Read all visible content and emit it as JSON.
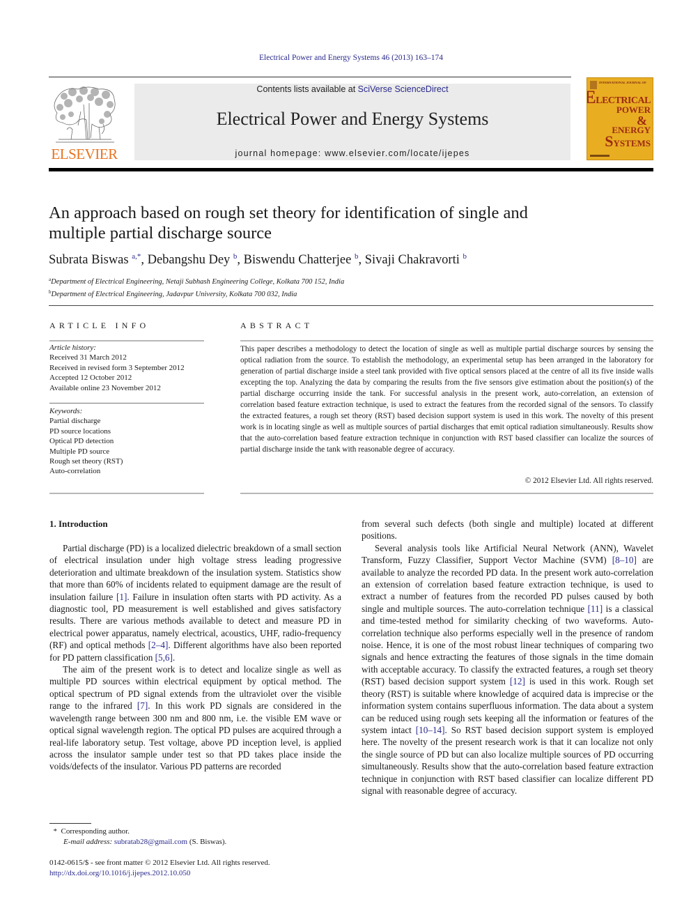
{
  "header": {
    "citation": "Electrical Power and Energy Systems 46 (2013) 163–174",
    "contents_prefix": "Contents lists available at ",
    "contents_link": "SciVerse ScienceDirect",
    "journal_name": "Electrical Power and Energy Systems",
    "homepage": "journal homepage: www.elsevier.com/locate/ijepes",
    "publisher_logo": "ELSEVIER",
    "cover": {
      "intl": "INTERNATIONAL JOURNAL OF",
      "line1_big": "E",
      "line1": "LECTRICAL",
      "line2": "POWER",
      "line3": "&",
      "line4": "ENERGY",
      "line5_big": "S",
      "line5": "YSTEMS"
    }
  },
  "article": {
    "title": "An approach based on rough set theory for identification of single and multiple partial discharge source",
    "authors": [
      {
        "name": "Subrata Biswas",
        "sup": "a,*"
      },
      {
        "name": "Debangshu Dey",
        "sup": "b"
      },
      {
        "name": "Biswendu Chatterjee",
        "sup": "b"
      },
      {
        "name": "Sivaji Chakravorti",
        "sup": "b"
      }
    ],
    "affiliations": [
      {
        "mark": "a",
        "text": "Department of Electrical Engineering, Netaji Subhash Engineering College, Kolkata 700 152, India"
      },
      {
        "mark": "b",
        "text": "Department of Electrical Engineering, Jadavpur University, Kolkata 700 032, India"
      }
    ]
  },
  "article_info": {
    "heading": "ARTICLE INFO",
    "history_label": "Article history:",
    "history": [
      "Received 31 March 2012",
      "Received in revised form 3 September 2012",
      "Accepted 12 October 2012",
      "Available online 23 November 2012"
    ],
    "keywords_label": "Keywords:",
    "keywords": [
      "Partial discharge",
      "PD source locations",
      "Optical PD detection",
      "Multiple PD source",
      "Rough set theory (RST)",
      "Auto-correlation"
    ]
  },
  "abstract": {
    "heading": "ABSTRACT",
    "text": "This paper describes a methodology to detect the location of single as well as multiple partial discharge sources by sensing the optical radiation from the source. To establish the methodology, an experimental setup has been arranged in the laboratory for generation of partial discharge inside a steel tank provided with five optical sensors placed at the centre of all its five inside walls excepting the top. Analyzing the data by comparing the results from the five sensors give estimation about the position(s) of the partial discharge occurring inside the tank. For successful analysis in the present work, auto-correlation, an extension of correlation based feature extraction technique, is used to extract the features from the recorded signal of the sensors. To classify the extracted features, a rough set theory (RST) based decision support system is used in this work. The novelty of this present work is in locating single as well as multiple sources of partial discharges that emit optical radiation simultaneously. Results show that the auto-correlation based feature extraction technique in conjunction with RST based classifier can localize the sources of partial discharge inside the tank with reasonable degree of accuracy.",
    "copyright": "© 2012 Elsevier Ltd. All rights reserved."
  },
  "introduction": {
    "heading": "1. Introduction",
    "p1": {
      "a": "Partial discharge (PD) is a localized dielectric breakdown of a small section of electrical insulation under high voltage stress leading progressive deterioration and ultimate breakdown of the insulation system. Statistics show that more than 60% of incidents related to equipment damage are the result of insulation failure ",
      "ref1": "[1]",
      "b": ". Failure in insulation often starts with PD activity. As a diagnostic tool, PD measurement is well established and gives satisfactory results. There are various methods available to detect and measure PD in electrical power apparatus, namely electrical, acoustics, UHF, radio-frequency (RF) and optical methods ",
      "ref2": "[2–4]",
      "c": ". Different algorithms have also been reported for PD pattern classification ",
      "ref3": "[5,6]",
      "d": "."
    },
    "p2": {
      "a": "The aim of the present work is to detect and localize single as well as multiple PD sources within electrical equipment by optical method. The optical spectrum of PD signal extends from the ultraviolet over the visible range to the infrared ",
      "ref1": "[7]",
      "b": ". In this work PD signals are considered in the wavelength range between 300 nm and 800 nm, i.e. the visible EM wave or optical signal wavelength region. The optical PD pulses are acquired through a real-life laboratory setup. Test voltage, above PD inception level, is applied across the insulator sample under test so that PD takes place inside the voids/defects of the insulator. Various PD patterns are recorded from several such defects (both single and multiple) located at different positions."
    },
    "p2_split": {
      "left": "The aim of the present work is to detect and localize single as well as multiple PD sources within electrical equipment by optical method. The optical spectrum of PD signal extends from the ultraviolet over the visible range to the infrared ",
      "ref1": "[7]",
      "left_b": ". In this work PD signals are considered in the wavelength range between 300 nm and 800 nm, i.e. the visible EM wave or optical signal wavelength region. The optical PD pulses are acquired through a real-life laboratory setup. Test voltage, above PD inception level, is applied across the insulator sample under test so that PD takes place inside the voids/defects of the insulator. Various PD patterns are recorded",
      "right": "from several such defects (both single and multiple) located at different positions."
    },
    "p3": {
      "a": "Several analysis tools like Artificial Neural Network (ANN), Wavelet Transform, Fuzzy Classifier, Support Vector Machine (SVM) ",
      "ref1": "[8–10]",
      "b": " are available to analyze the recorded PD data. In the present work auto-correlation an extension of correlation based feature extraction technique, is used to extract a number of features from the recorded PD pulses caused by both single and multiple sources. The auto-correlation technique ",
      "ref2": "[11]",
      "c": " is a classical and time-tested method for similarity checking of two waveforms. Auto-correlation technique also performs especially well in the presence of random noise. Hence, it is one of the most robust linear techniques of comparing two signals and hence extracting the features of those signals in the time domain with acceptable accuracy. To classify the extracted features, a rough set theory (RST) based decision support system ",
      "ref3": "[12]",
      "d": " is used in this work. Rough set theory (RST) is suitable where knowledge of acquired data is imprecise or the information system contains superfluous information. The data about a system can be reduced using rough sets keeping all the information or features of the system intact ",
      "ref4": "[10–14]",
      "e": ". So RST based decision support system is employed here. The novelty of the present research work is that it can localize not only the single source of PD but can also localize multiple sources of PD occurring simultaneously. Results show that the auto-correlation based feature extraction technique in conjunction with RST based classifier can localize different PD signal with reasonable degree of accuracy."
    }
  },
  "footnotes": {
    "mark": "*",
    "corresponding": "Corresponding author.",
    "email_label": "E-mail address:",
    "email": "subratab28@gmail.com",
    "email_suffix": " (S. Biswas).",
    "issn_line": "0142-0615/$ - see front matter © 2012 Elsevier Ltd. All rights reserved.",
    "doi": "http://dx.doi.org/10.1016/j.ijepes.2012.10.050"
  },
  "colors": {
    "link": "#2a2a8c",
    "elsevier_orange": "#e8731e",
    "cover_bg": "#e9ad22",
    "cover_text": "#9c2b12",
    "masthead_bg": "#ebebeb"
  }
}
